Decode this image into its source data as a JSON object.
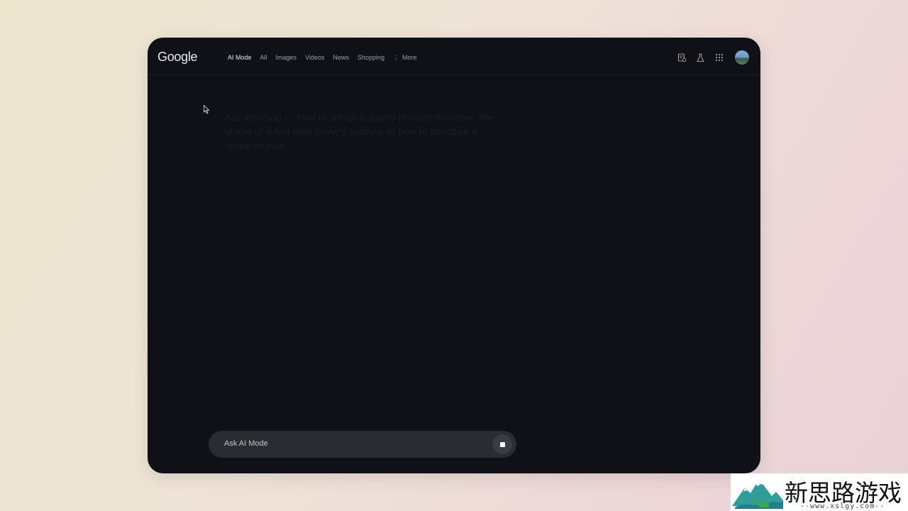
{
  "app": {
    "logo_text": "Google"
  },
  "nav": {
    "tabs": [
      {
        "label": "AI Mode",
        "active": true
      },
      {
        "label": "All",
        "active": false
      },
      {
        "label": "Images",
        "active": false
      },
      {
        "label": "Videos",
        "active": false
      },
      {
        "label": "News",
        "active": false
      },
      {
        "label": "Shopping",
        "active": false
      },
      {
        "label": "More",
        "active": false
      }
    ]
  },
  "toolbar": {
    "icons": [
      "search-history-icon",
      "labs-flask-icon",
      "apps-grid-icon",
      "account-avatar"
    ]
  },
  "main": {
    "ghost_text": "Ask anything — how to set up a quality product narrative, the shape of a first-time buyer's journey, or how to structure a research plan."
  },
  "search": {
    "placeholder": "Ask AI Mode",
    "stop_icon": "stop-square-icon"
  },
  "colors": {
    "window_bg": "#101116",
    "askbar_bg": "#2a2b33",
    "text_primary": "#e8eaed",
    "text_secondary": "#9aa0a6"
  },
  "watermark": {
    "title": "新思路游戏",
    "url": "--www.xslgy.com--"
  }
}
